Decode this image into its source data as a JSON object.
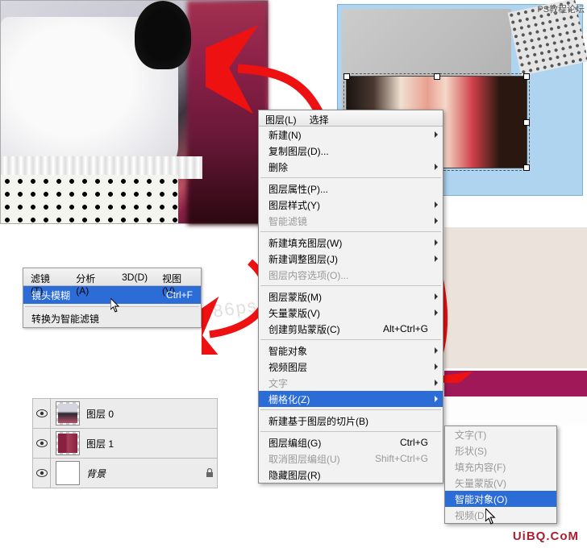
{
  "watermarks": {
    "top": "PS教程论坛",
    "bottom": "UiBQ.CoM",
    "mid": "86ps"
  },
  "filter_menu": {
    "tabs": [
      "滤镜(T)",
      "分析(A)",
      "3D(D)",
      "视图(V)"
    ],
    "lens_blur": "镜头模糊",
    "lens_shortcut": "Ctrl+F",
    "smart": "转换为智能滤镜"
  },
  "layer_menu_tabs": [
    "图层(L)",
    "选择"
  ],
  "layer_menu": [
    {
      "label": "新建(N)",
      "sub": true
    },
    {
      "label": "复制图层(D)..."
    },
    {
      "label": "删除",
      "sub": true
    },
    {
      "sep": true
    },
    {
      "label": "图层属性(P)..."
    },
    {
      "label": "图层样式(Y)",
      "sub": true
    },
    {
      "label": "智能滤镜",
      "dis": true,
      "sub": true
    },
    {
      "sep": true
    },
    {
      "label": "新建填充图层(W)",
      "sub": true
    },
    {
      "label": "新建调整图层(J)",
      "sub": true
    },
    {
      "label": "图层内容选项(O)...",
      "dis": true
    },
    {
      "sep": true
    },
    {
      "label": "图层蒙版(M)",
      "sub": true
    },
    {
      "label": "矢量蒙版(V)",
      "sub": true
    },
    {
      "label": "创建剪贴蒙版(C)",
      "shortcut": "Alt+Ctrl+G"
    },
    {
      "sep": true
    },
    {
      "label": "智能对象",
      "sub": true
    },
    {
      "label": "视频图层",
      "sub": true
    },
    {
      "label": "文字",
      "dis": true,
      "sub": true
    },
    {
      "label": "栅格化(Z)",
      "sub": true,
      "hl": true
    },
    {
      "sep": true
    },
    {
      "label": "新建基于图层的切片(B)"
    },
    {
      "sep": true
    },
    {
      "label": "图层编组(G)",
      "shortcut": "Ctrl+G"
    },
    {
      "label": "取消图层编组(U)",
      "shortcut": "Shift+Ctrl+G",
      "dis": true
    },
    {
      "label": "隐藏图层(R)"
    }
  ],
  "submenu": [
    {
      "label": "文字(T)",
      "dis": true
    },
    {
      "label": "形状(S)",
      "dis": true
    },
    {
      "label": "填充内容(F)",
      "dis": true
    },
    {
      "label": "矢量蒙版(V)",
      "dis": true
    },
    {
      "label": "智能对象(O)",
      "hl": true
    },
    {
      "label": "视频(D)",
      "dis": true
    }
  ],
  "layers": [
    {
      "name": "图层 0"
    },
    {
      "name": "图层 1"
    },
    {
      "name": "背景",
      "locked": true,
      "italic": true
    }
  ]
}
